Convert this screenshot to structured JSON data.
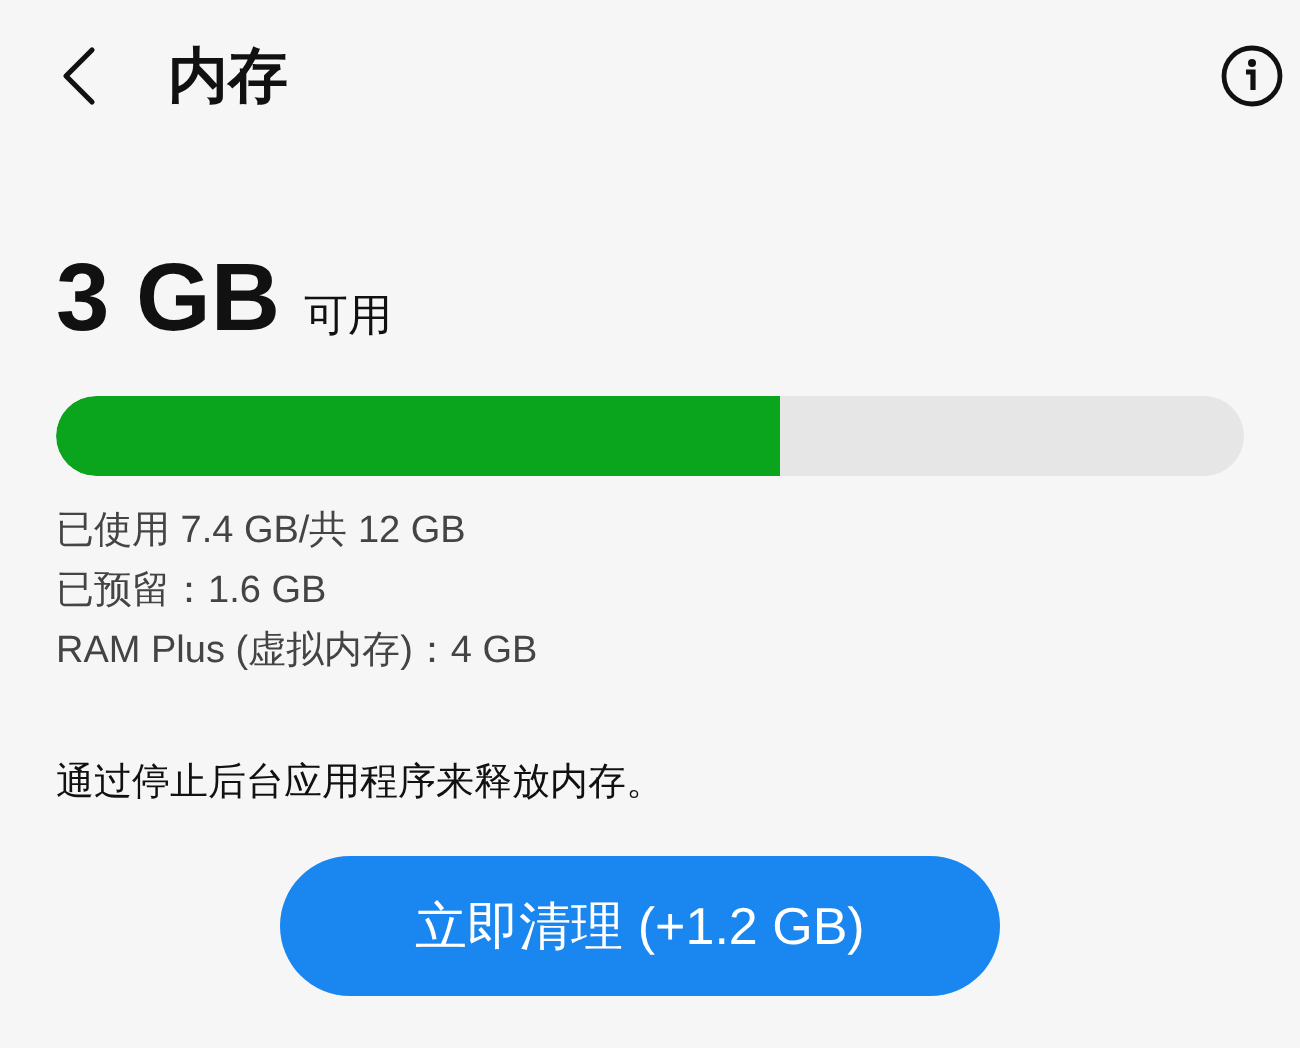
{
  "header": {
    "title": "内存"
  },
  "available": {
    "value": "3 GB",
    "unit": "可用"
  },
  "usage_bar": {
    "level": 0.61
  },
  "details": [
    "已使用 7.4 GB/共 12 GB",
    "已预留：1.6 GB",
    "RAM Plus (虚拟内存)：4 GB"
  ],
  "description": "通过停止后台应用程序来释放内存。",
  "clean_button": {
    "label": "立即清理 (+1.2 GB)"
  }
}
